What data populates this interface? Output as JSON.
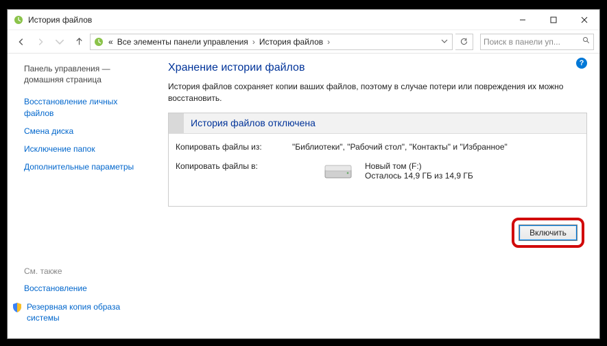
{
  "titlebar": {
    "title": "История файлов"
  },
  "breadcrumb": {
    "prefix": "«",
    "item1": "Все элементы панели управления",
    "item2": "История файлов"
  },
  "search": {
    "placeholder": "Поиск в панели уп..."
  },
  "sidebar": {
    "home": "Панель управления — домашняя страница",
    "restore": "Восстановление личных файлов",
    "change_drive": "Смена диска",
    "exclude": "Исключение папок",
    "advanced": "Дополнительные параметры",
    "see_also": "См. также",
    "recovery": "Восстановление",
    "system_backup": "Резервная копия образа системы"
  },
  "main": {
    "heading": "Хранение истории файлов",
    "description": "История файлов сохраняет копии ваших файлов, поэтому в случае потери или повреждения их можно восстановить.",
    "status_title": "История файлов отключена",
    "copy_from_label": "Копировать файлы из:",
    "copy_from_value": "\"Библиотеки\", \"Рабочий стол\", \"Контакты\" и \"Избранное\"",
    "copy_to_label": "Копировать файлы в:",
    "drive_name": "Новый том (F:)",
    "drive_space": "Осталось 14,9 ГБ из 14,9 ГБ",
    "enable_button": "Включить",
    "help": "?"
  }
}
